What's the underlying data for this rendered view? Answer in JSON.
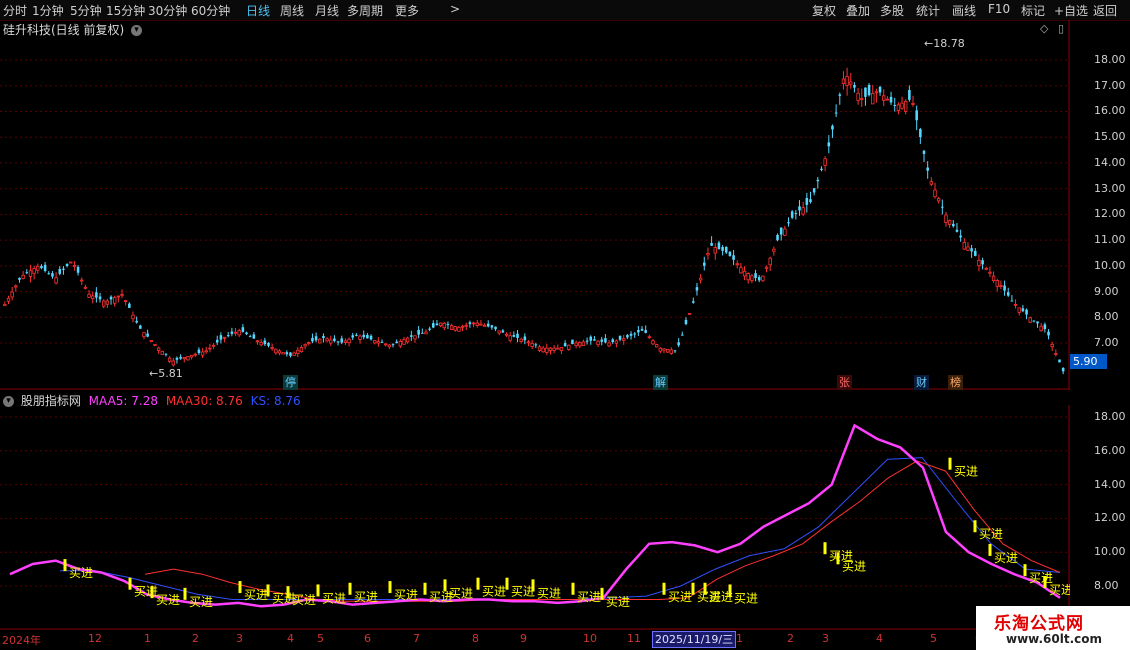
{
  "toolbar": {
    "periods": [
      "分时",
      "1分钟",
      "5分钟",
      "15分钟",
      "30分钟",
      "60分钟",
      "日线",
      "周线",
      "月线",
      "多周期",
      "更多"
    ],
    "active_period": "日线",
    "actions": [
      "复权",
      "叠加",
      "多股",
      "统计",
      "画线",
      "F10",
      "标记",
      "+自选",
      "返回"
    ]
  },
  "stock": {
    "title": "硅升科技(日线 前复权)",
    "high_label": "18.78",
    "low_label": "5.81",
    "current_price": "5.90"
  },
  "price_axis": [
    "18.00",
    "17.00",
    "16.00",
    "15.00",
    "14.00",
    "13.00",
    "12.00",
    "11.00",
    "10.00",
    "9.00",
    "8.00",
    "7.00"
  ],
  "events": [
    {
      "label": "停",
      "kind": "stop"
    },
    {
      "label": "解",
      "kind": "jie"
    },
    {
      "label": "张",
      "kind": "zhang"
    },
    {
      "label": "财",
      "kind": "cai"
    },
    {
      "label": "榜",
      "kind": "rank"
    }
  ],
  "indicator": {
    "name": "股朋指标网",
    "maa5_label": "MAA5: 7.28",
    "maa30_label": "MAA30: 8.76",
    "ks_label": "KS: 8.76",
    "axis": [
      "18.00",
      "16.00",
      "14.00",
      "12.00",
      "10.00",
      "8.00"
    ],
    "signal_text": "买进",
    "colors": {
      "maa5": "#ff40ff",
      "maa30": "#ff3030",
      "ks": "#3050ff",
      "signal": "#ffff00"
    }
  },
  "date_axis": {
    "labels": [
      "2024年",
      "12",
      "1",
      "2",
      "3",
      "4",
      "5",
      "6",
      "7",
      "8",
      "9",
      "10",
      "11",
      "2025/11/19/三",
      "1",
      "2",
      "3",
      "4",
      "5",
      "6"
    ],
    "highlight": "2025/11/19/三"
  },
  "watermark": {
    "title": "乐淘公式网",
    "url": "www.60lt.com"
  },
  "chart_data": {
    "type": "line",
    "title": "硅升科技(日线 前复权)",
    "xlabel": "",
    "ylabel": "",
    "ylim": [
      6.3,
      18.8
    ],
    "x_labels": [
      "2024年",
      "12",
      "1",
      "2",
      "3",
      "4",
      "5",
      "6",
      "7",
      "8",
      "9",
      "10",
      "11",
      "1",
      "2",
      "3",
      "4",
      "5",
      "6"
    ],
    "series": [
      {
        "name": "Close",
        "values": [
          8.5,
          9.6,
          10.0,
          9.5,
          10.2,
          8.9,
          8.6,
          8.9,
          7.6,
          6.9,
          6.3,
          6.5,
          6.7,
          7.2,
          7.5,
          7.1,
          6.8,
          6.5,
          7.0,
          7.2,
          7.0,
          7.3,
          7.1,
          6.9,
          7.2,
          7.4,
          7.8,
          7.6,
          7.8,
          7.6,
          7.3,
          7.1,
          6.8,
          6.8,
          7.0,
          7.1,
          7.0,
          7.2,
          7.5,
          6.8,
          6.7,
          8.6,
          10.8,
          10.5,
          9.8,
          9.4,
          11.0,
          12.0,
          12.5,
          14.5,
          17.5,
          16.5,
          16.8,
          16.2,
          16.5,
          13.5,
          12.0,
          11.0,
          10.2,
          9.5,
          8.6,
          8.0,
          7.5,
          5.9
        ]
      },
      {
        "name": "MAA5",
        "values": [
          8.7,
          9.3,
          9.5,
          9.0,
          8.8,
          8.3,
          7.5,
          7.2,
          7.0,
          6.9,
          7.0,
          6.8,
          6.9,
          7.2,
          7.1,
          6.9,
          7.0,
          7.1,
          7.2,
          7.1,
          7.2,
          7.2,
          7.1,
          7.1,
          7.0,
          7.1,
          7.3,
          9.0,
          10.5,
          10.6,
          10.4,
          10.0,
          10.5,
          11.5,
          12.2,
          12.9,
          14.0,
          17.5,
          16.7,
          16.2,
          15.0,
          11.2,
          10.0,
          9.3,
          8.7,
          8.2,
          7.3
        ]
      },
      {
        "name": "MAA30",
        "values": [
          8.7,
          9.0,
          8.7,
          8.2,
          7.8,
          7.5,
          7.2,
          7.1,
          7.1,
          7.1,
          7.1,
          7.1,
          7.2,
          7.2,
          7.2,
          7.2,
          7.2,
          7.2,
          7.2,
          7.3,
          8.4,
          9.2,
          9.8,
          10.5,
          11.8,
          13.0,
          14.4,
          15.4,
          14.8,
          12.5,
          10.5,
          9.5,
          8.8
        ]
      },
      {
        "name": "KS",
        "values": [
          8.9,
          8.9,
          8.5,
          8.0,
          7.5,
          7.2,
          7.2,
          7.2,
          7.2,
          7.2,
          7.2,
          7.2,
          7.2,
          7.2,
          7.2,
          7.2,
          7.3,
          7.4,
          8.0,
          9.0,
          9.8,
          10.2,
          11.5,
          13.5,
          15.5,
          15.6,
          13.0,
          10.5,
          9.0,
          8.8
        ]
      }
    ]
  }
}
